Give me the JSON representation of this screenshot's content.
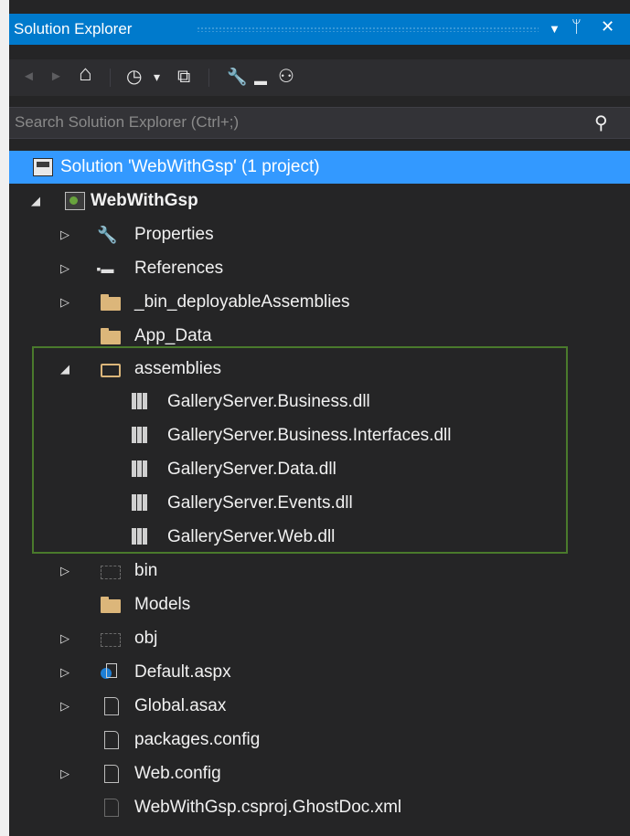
{
  "window": {
    "title": "Solution Explorer",
    "dropdown_glyph": "▼",
    "pin_glyph": "ᛘ",
    "close_glyph": "✕"
  },
  "toolbar": {
    "icons": [
      "back-icon",
      "forward-icon",
      "home-icon",
      "history-icon",
      "collapse-all-icon",
      "properties-wrench-icon",
      "hide-icon",
      "view-class-diagram-icon"
    ],
    "glyphs": {
      "back": "◄",
      "forward": "►",
      "home": "⌂",
      "history": "◷",
      "dropdown": "▾",
      "collapse": "⧉",
      "wrench": "🔧",
      "minus": "▬",
      "diagram": "⚇"
    }
  },
  "search": {
    "placeholder": "Search Solution Explorer (Ctrl+;)",
    "value": "",
    "icon": "search-icon",
    "glyph": "⚲"
  },
  "tree": {
    "solution": "Solution 'WebWithGsp' (1 project)",
    "project": "WebWithGsp",
    "items": {
      "properties": "Properties",
      "references": "References",
      "bin_deployable": "_bin_deployableAssemblies",
      "app_data": "App_Data",
      "assemblies": "assemblies",
      "dll1": "GalleryServer.Business.dll",
      "dll2": "GalleryServer.Business.Interfaces.dll",
      "dll3": "GalleryServer.Data.dll",
      "dll4": "GalleryServer.Events.dll",
      "dll5": "GalleryServer.Web.dll",
      "bin": "bin",
      "models": "Models",
      "obj": "obj",
      "default_aspx": "Default.aspx",
      "global_asax": "Global.asax",
      "packages_config": "packages.config",
      "web_config": "Web.config",
      "ghostdoc": "WebWithGsp.csproj.GhostDoc.xml"
    },
    "glyphs": {
      "expanded": "◢",
      "collapsed": "▷",
      "wrench": "🔧",
      "references": "▪▬",
      "config": "↲"
    },
    "colors": {
      "selection": "#3399ff",
      "highlight_border": "#4a7a2c",
      "folder": "#dcb67a"
    }
  }
}
